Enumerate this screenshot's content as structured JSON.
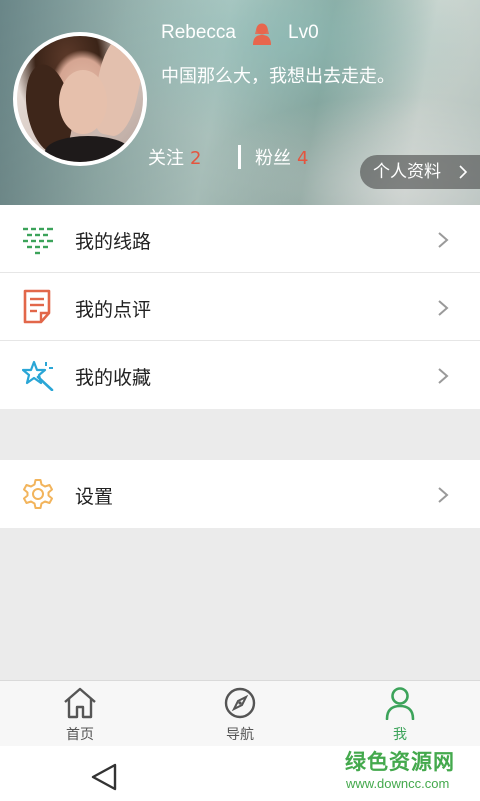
{
  "profile": {
    "username": "Rebecca",
    "gender_icon": "female-user-icon",
    "level": "Lv0",
    "motto": "中国那么大，我想出去走走。",
    "follow_label": "关注",
    "follow_count": "2",
    "fans_label": "粉丝",
    "fans_count": "4",
    "profile_button_label": "个人资料"
  },
  "menu": {
    "items": [
      {
        "label": "我的线路",
        "icon": "route-list-icon",
        "color": "#3ca35a"
      },
      {
        "label": "我的点评",
        "icon": "review-note-icon",
        "color": "#e2674a"
      },
      {
        "label": "我的收藏",
        "icon": "star-wand-icon",
        "color": "#2aa6d6"
      }
    ],
    "settings": {
      "label": "设置",
      "icon": "gear-icon",
      "color": "#f2b45c"
    }
  },
  "tabs": [
    {
      "label": "首页",
      "icon": "home-icon",
      "active": false
    },
    {
      "label": "导航",
      "icon": "compass-icon",
      "active": false
    },
    {
      "label": "我",
      "icon": "person-icon",
      "active": true
    }
  ],
  "colors": {
    "accent_green": "#3ca35a",
    "count_red": "#e4553f"
  },
  "watermark": {
    "title": "绿色资源网",
    "url": "www.downcc.com"
  }
}
